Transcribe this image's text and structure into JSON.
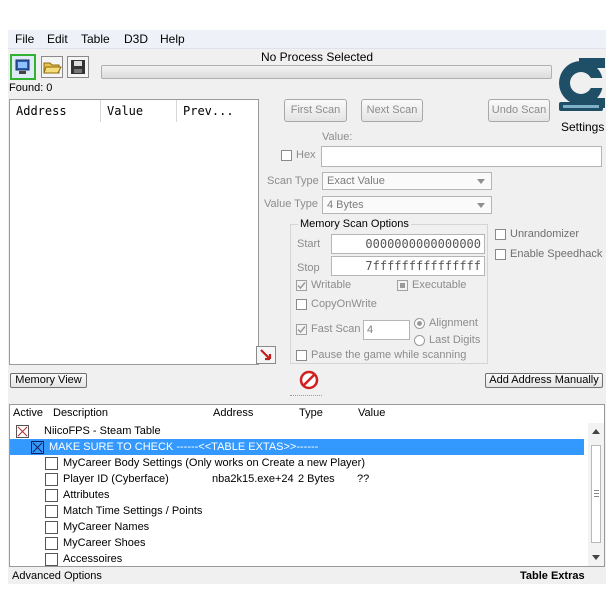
{
  "menu": [
    "File",
    "Edit",
    "Table",
    "D3D",
    "Help"
  ],
  "process_label": "No Process Selected",
  "found": "Found: 0",
  "settings_label": "Settings",
  "results_columns": [
    "Address",
    "Value",
    "Prev..."
  ],
  "buttons": {
    "first_scan": "First Scan",
    "next_scan": "Next Scan",
    "undo_scan": "Undo Scan",
    "memory_view": "Memory View",
    "add_address": "Add Address Manually"
  },
  "scan": {
    "value_label": "Value:",
    "hex_label": "Hex",
    "scan_type_label": "Scan Type",
    "scan_type_value": "Exact Value",
    "value_type_label": "Value Type",
    "value_type_value": "4 Bytes"
  },
  "memory_options": {
    "title": "Memory Scan Options",
    "start_label": "Start",
    "start_value": "0000000000000000",
    "stop_label": "Stop",
    "stop_value": "7fffffffffffffff",
    "writable": "Writable",
    "executable": "Executable",
    "copy_on_write": "CopyOnWrite",
    "fast_scan": "Fast Scan",
    "fast_scan_value": "4",
    "alignment": "Alignment",
    "last_digits": "Last Digits",
    "pause": "Pause the game while scanning"
  },
  "extra_options": {
    "unrandomizer": "Unrandomizer",
    "speedhack": "Enable Speedhack"
  },
  "table_columns": [
    "Active",
    "Description",
    "Address",
    "Type",
    "Value"
  ],
  "table_rows": [
    {
      "desc": "NiicoFPS - Steam Table",
      "address": "",
      "type": "",
      "value": "",
      "indent": 0,
      "checkbox": "x",
      "selected": false
    },
    {
      "desc": "MAKE SURE TO CHECK ------<<TABLE EXTAS>>------",
      "address": "",
      "type": "",
      "value": "",
      "indent": 1,
      "checkbox": "x",
      "selected": true
    },
    {
      "desc": "MyCareer Body Settings (Only works on Create a new Player)",
      "address": "",
      "type": "",
      "value": "",
      "indent": 2,
      "checkbox": "box",
      "selected": false
    },
    {
      "desc": "Player ID (Cyberface)",
      "address": "nba2k15.exe+24",
      "type": "2 Bytes",
      "value": "??",
      "indent": 2,
      "checkbox": "box",
      "selected": false
    },
    {
      "desc": "Attributes",
      "address": "",
      "type": "",
      "value": "",
      "indent": 2,
      "checkbox": "box",
      "selected": false
    },
    {
      "desc": "Match Time Settings / Points",
      "address": "",
      "type": "",
      "value": "",
      "indent": 2,
      "checkbox": "box",
      "selected": false
    },
    {
      "desc": "MyCareer Names",
      "address": "",
      "type": "",
      "value": "",
      "indent": 2,
      "checkbox": "box",
      "selected": false
    },
    {
      "desc": "MyCareer Shoes",
      "address": "",
      "type": "",
      "value": "",
      "indent": 2,
      "checkbox": "box",
      "selected": false
    },
    {
      "desc": "Accessoires",
      "address": "",
      "type": "",
      "value": "",
      "indent": 2,
      "checkbox": "box",
      "selected": false
    }
  ],
  "status": {
    "left": "Advanced Options",
    "right": "Table Extras"
  }
}
